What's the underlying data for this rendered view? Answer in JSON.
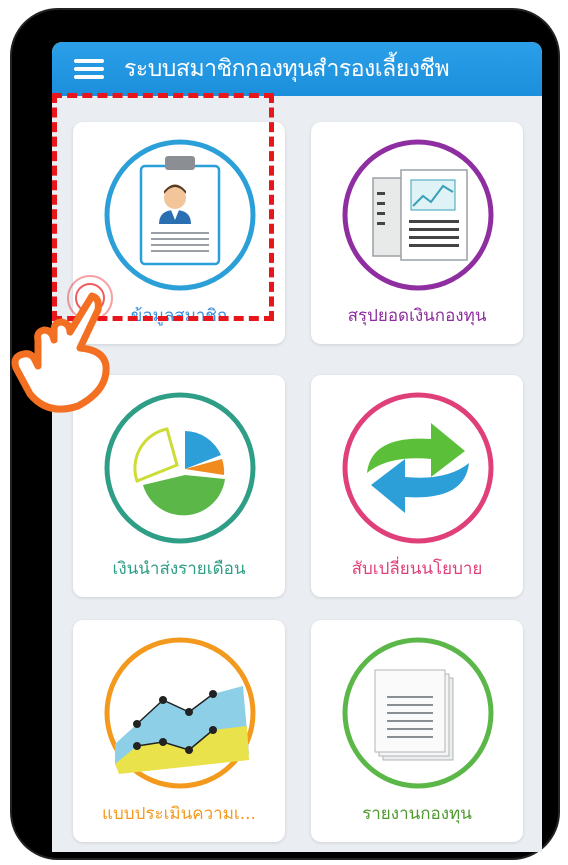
{
  "app": {
    "title": "ระบบสมาชิกกองทุนสำรองเลี้ยงชีพ"
  },
  "colors": {
    "header": "#1c8fdc",
    "highlight": "#e8151b",
    "hand": "#f36f21"
  },
  "menu": [
    {
      "label": "ข้อมูลสมาชิก",
      "icon": "member-card-icon",
      "color": "#3b8fd9"
    },
    {
      "label": "สรุปยอดเงินกองทุน",
      "icon": "fund-summary-document-icon",
      "color": "#8e2ea0"
    },
    {
      "label": "เงินนำส่งรายเดือน",
      "icon": "pie-chart-icon",
      "color": "#2f9e86"
    },
    {
      "label": "สับเปลี่ยนนโยบาย",
      "icon": "switch-arrows-icon",
      "color": "#e0407a"
    },
    {
      "label": "แบบประเมินความเ...",
      "icon": "area-chart-icon",
      "color": "#f39a1e"
    },
    {
      "label": "รายงานกองทุน",
      "icon": "report-paper-icon",
      "color": "#4e9a2e"
    }
  ]
}
